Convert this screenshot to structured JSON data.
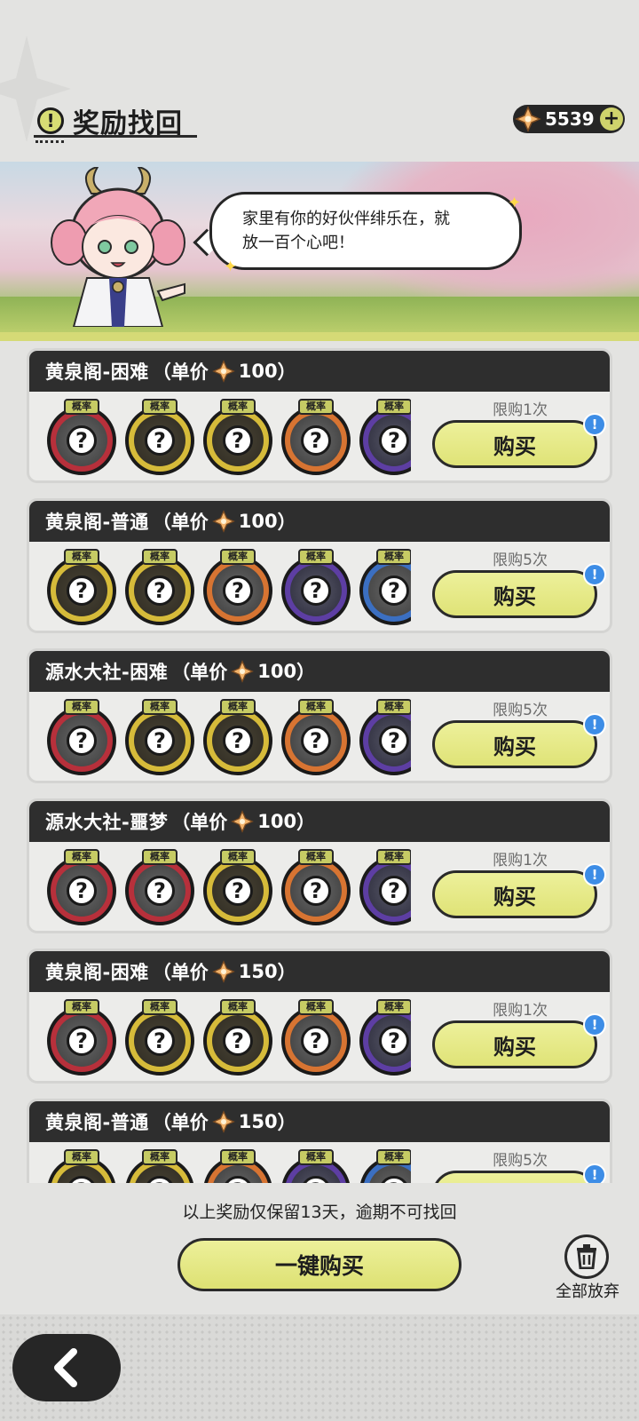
{
  "header": {
    "title": "奖励找回",
    "title_icon": "exclamation-icon",
    "currency_value": "5539",
    "currency_icon": "gem-icon"
  },
  "banner": {
    "speech_line1": "家里有你的好伙伴绯乐在，就",
    "speech_line2": "放一百个心吧！"
  },
  "rate_label": "概率",
  "price_prefix": "（单价",
  "price_suffix": "）",
  "buy_label": "购买",
  "cards": [
    {
      "title": "黄泉阁-困难",
      "price": "100",
      "limit": "限购1次",
      "items": [
        "red",
        "gold",
        "gold",
        "orange",
        "purple"
      ]
    },
    {
      "title": "黄泉阁-普通",
      "price": "100",
      "limit": "限购5次",
      "items": [
        "gold",
        "gold",
        "orange",
        "purple",
        "blue"
      ]
    },
    {
      "title": "源水大社-困难",
      "price": "100",
      "limit": "限购5次",
      "items": [
        "red",
        "gold",
        "gold",
        "orange",
        "purple"
      ]
    },
    {
      "title": "源水大社-噩梦",
      "price": "100",
      "limit": "限购1次",
      "items": [
        "red",
        "red",
        "gold",
        "orange",
        "purple"
      ]
    },
    {
      "title": "黄泉阁-困难",
      "price": "150",
      "limit": "限购1次",
      "items": [
        "red",
        "gold",
        "gold",
        "orange",
        "purple"
      ]
    },
    {
      "title": "黄泉阁-普通",
      "price": "150",
      "limit": "限购5次",
      "items": [
        "gold",
        "gold",
        "orange",
        "purple",
        "blue"
      ]
    }
  ],
  "footer": {
    "note": "以上奖励仅保留13天，逾期不可找回",
    "bulk_buy": "一键购买",
    "discard_all": "全部放弃"
  },
  "colors": {
    "accent": "#dfe377",
    "header_bar": "#2e2e2e",
    "alert": "#3d8de6"
  }
}
